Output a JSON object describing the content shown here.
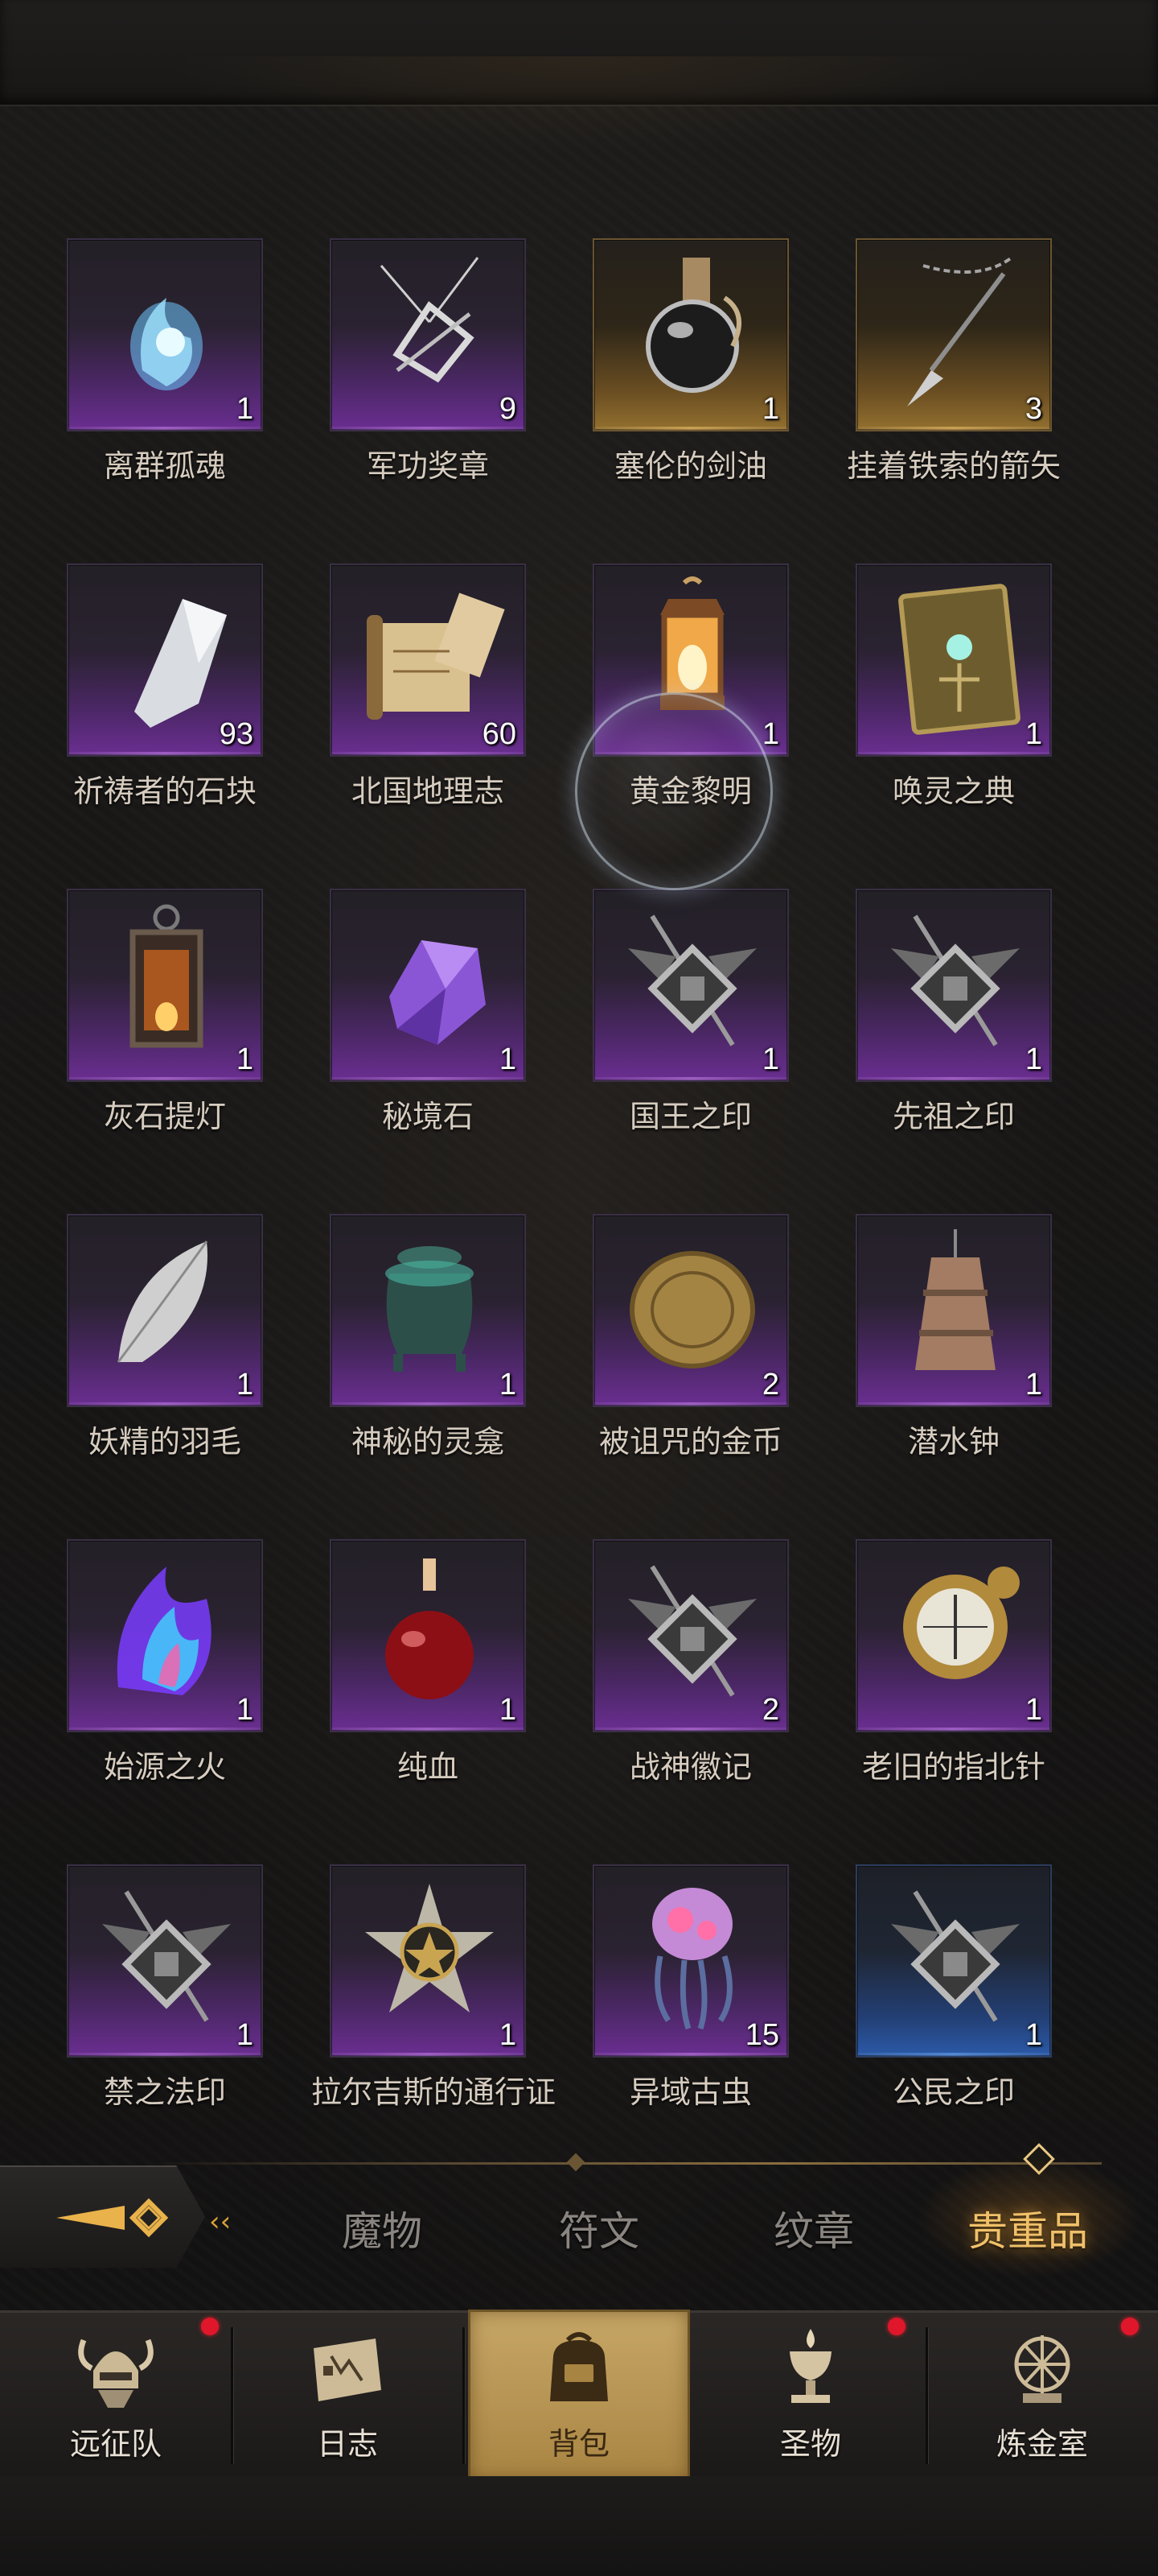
{
  "items": [
    {
      "name": "离群孤魂",
      "count": "1",
      "rarity": "purple",
      "icon": "wisp-soul-icon"
    },
    {
      "name": "军功奖章",
      "count": "9",
      "rarity": "purple",
      "icon": "medal-icon"
    },
    {
      "name": "塞伦的剑油",
      "count": "1",
      "rarity": "gold",
      "icon": "oil-flask-icon"
    },
    {
      "name": "挂着铁索的箭矢",
      "count": "3",
      "rarity": "gold",
      "icon": "chained-arrow-icon"
    },
    {
      "name": "祈祷者的石块",
      "count": "93",
      "rarity": "purple",
      "icon": "stone-icon"
    },
    {
      "name": "北国地理志",
      "count": "60",
      "rarity": "purple",
      "icon": "scroll-icon"
    },
    {
      "name": "黄金黎明",
      "count": "1",
      "rarity": "purple",
      "icon": "golden-lantern-icon"
    },
    {
      "name": "唤灵之典",
      "count": "1",
      "rarity": "purple",
      "icon": "tome-icon"
    },
    {
      "name": "灰石提灯",
      "count": "1",
      "rarity": "purple",
      "icon": "lantern-icon"
    },
    {
      "name": "秘境石",
      "count": "1",
      "rarity": "purple",
      "icon": "crystal-icon"
    },
    {
      "name": "国王之印",
      "count": "1",
      "rarity": "purple",
      "icon": "seal-emblem-icon"
    },
    {
      "name": "先祖之印",
      "count": "1",
      "rarity": "purple",
      "icon": "seal-emblem-icon"
    },
    {
      "name": "妖精的羽毛",
      "count": "1",
      "rarity": "purple",
      "icon": "feather-icon"
    },
    {
      "name": "神秘的灵龛",
      "count": "1",
      "rarity": "purple",
      "icon": "shrine-urn-icon"
    },
    {
      "name": "被诅咒的金币",
      "count": "2",
      "rarity": "purple",
      "icon": "gold-coin-icon"
    },
    {
      "name": "潜水钟",
      "count": "1",
      "rarity": "purple",
      "icon": "diving-bell-icon"
    },
    {
      "name": "始源之火",
      "count": "1",
      "rarity": "purple",
      "icon": "prismatic-flame-icon"
    },
    {
      "name": "纯血",
      "count": "1",
      "rarity": "purple",
      "icon": "blood-potion-icon"
    },
    {
      "name": "战神徽记",
      "count": "2",
      "rarity": "purple",
      "icon": "seal-emblem-icon"
    },
    {
      "name": "老旧的指北针",
      "count": "1",
      "rarity": "purple",
      "icon": "compass-icon"
    },
    {
      "name": "禁之法印",
      "count": "1",
      "rarity": "purple",
      "icon": "seal-emblem-icon"
    },
    {
      "name": "拉尔吉斯的通行证",
      "count": "1",
      "rarity": "purple",
      "icon": "star-badge-icon"
    },
    {
      "name": "异域古虫",
      "count": "15",
      "rarity": "purple",
      "icon": "jellyfish-icon"
    },
    {
      "name": "公民之印",
      "count": "1",
      "rarity": "blue",
      "icon": "seal-emblem-icon"
    }
  ],
  "tabs": [
    {
      "label": "魔物",
      "active": false
    },
    {
      "label": "符文",
      "active": false
    },
    {
      "label": "纹章",
      "active": false
    },
    {
      "label": "贵重品",
      "active": true
    }
  ],
  "back_icon": "back-arrow-icon",
  "nav": [
    {
      "label": "远征队",
      "icon": "viking-helmet-icon",
      "badge": true,
      "active": false
    },
    {
      "label": "日志",
      "icon": "journal-map-icon",
      "badge": false,
      "active": false
    },
    {
      "label": "背包",
      "icon": "backpack-icon",
      "badge": false,
      "active": true
    },
    {
      "label": "圣物",
      "icon": "relic-chalice-icon",
      "badge": true,
      "active": false
    },
    {
      "label": "炼金室",
      "icon": "alchemy-icon",
      "badge": true,
      "active": false
    }
  ],
  "colors": {
    "accent_gold": "#f0c06a",
    "rarity_purple": "#6a2e91",
    "rarity_gold": "#93702f",
    "rarity_blue": "#2b5aa8",
    "badge_red": "#e0162b"
  }
}
